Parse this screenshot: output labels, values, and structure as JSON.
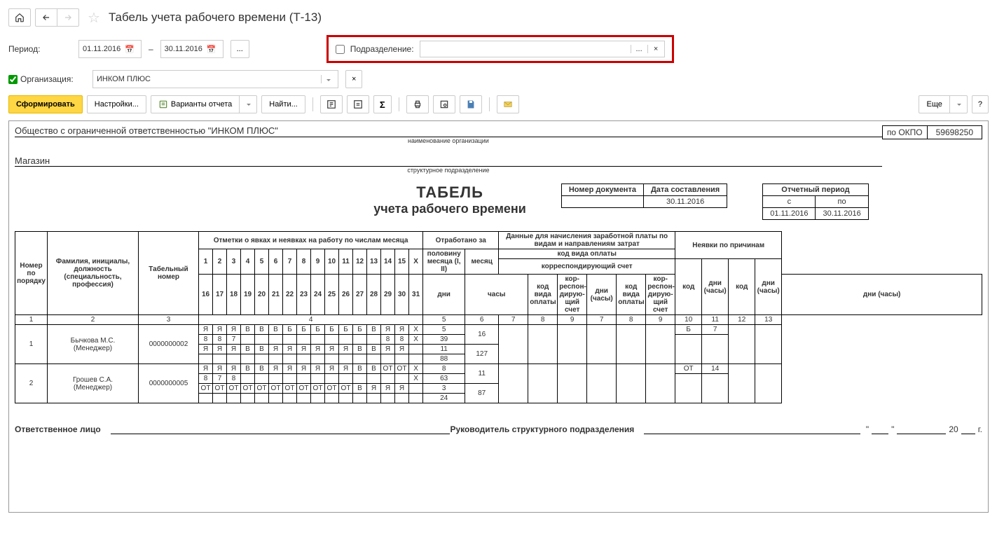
{
  "header": {
    "title": "Табель учета рабочего времени (Т-13)"
  },
  "filters": {
    "period_label": "Период:",
    "date_from": "01.11.2016",
    "date_dash": "–",
    "date_to": "30.11.2016",
    "dots": "...",
    "subdivision_label": "Подразделение:",
    "org_label": "Организация:",
    "org_value": "ИНКОМ ПЛЮС"
  },
  "toolbar": {
    "generate": "Сформировать",
    "settings": "Настройки...",
    "variants": "Варианты отчета",
    "find": "Найти...",
    "more": "Еще"
  },
  "report": {
    "org_name": "Общество с ограниченной ответственностью \"ИНКОМ ПЛЮС\"",
    "org_sub": "наименование организации",
    "okpo_label": "по ОКПО",
    "okpo_value": "59698250",
    "dept": "Магазин",
    "dept_sub": "структурное подразделение",
    "tabel1": "ТАБЕЛЬ",
    "tabel2": "учета  рабочего времени",
    "doc_number_label": "Номер документа",
    "doc_date_label": "Дата составления",
    "doc_date_value": "30.11.2016",
    "rep_period_label": "Отчетный период",
    "rep_from_label": "с",
    "rep_to_label": "по",
    "rep_from": "01.11.2016",
    "rep_to": "30.11.2016"
  },
  "columns": {
    "c1": "Номер по порядку",
    "c2": "Фамилия, инициалы, должность (специальность, профессия)",
    "c3": "Табельный номер",
    "c4": "Отметки о явках и неявках на работу по числам месяца",
    "c5": "Отработано за",
    "half": "половину месяца (I, II)",
    "month": "месяц",
    "days": "дни",
    "hours": "часы",
    "c6": "Данные для начисления заработной платы по видам и направлениям затрат",
    "pay_code": "код вида оплаты",
    "corr": "корреспондирующий счет",
    "kod": "код вида оплаты",
    "corr2": "кор-респон-дирую-щий счет",
    "dni": "дни (часы)",
    "c7": "Неявки по причинам",
    "abs_code": "код",
    "abs_days": "дни (часы)"
  },
  "day_row1": [
    "1",
    "2",
    "3",
    "4",
    "5",
    "6",
    "7",
    "8",
    "9",
    "10",
    "11",
    "12",
    "13",
    "14",
    "15",
    "X"
  ],
  "day_row2": [
    "16",
    "17",
    "18",
    "19",
    "20",
    "21",
    "22",
    "23",
    "24",
    "25",
    "26",
    "27",
    "28",
    "29",
    "30",
    "31"
  ],
  "colnums": {
    "a": "1",
    "b": "2",
    "c": "3",
    "d": "4",
    "e": "5",
    "f": "6",
    "g": "7",
    "h": "8",
    "i": "9",
    "j": "7",
    "k": "8",
    "l": "9",
    "m": "10",
    "n": "11",
    "o": "12",
    "p": "13"
  },
  "rows": [
    {
      "num": "1",
      "name": "Бычкова М.С.",
      "role": "(Менеджер)",
      "tab": "0000000002",
      "l1": [
        "Я",
        "Я",
        "Я",
        "В",
        "В",
        "В",
        "Б",
        "Б",
        "Б",
        "Б",
        "Б",
        "Б",
        "В",
        "Я",
        "Я",
        "X"
      ],
      "l2": [
        "8",
        "8",
        "7",
        "",
        "",
        "",
        "",
        "",
        "",
        "",
        "",
        "",
        "",
        "8",
        "8",
        "X"
      ],
      "l3": [
        "Я",
        "Я",
        "Я",
        "В",
        "В",
        "Я",
        "Я",
        "Я",
        "Я",
        "Я",
        "Я",
        "В",
        "В",
        "Я",
        "Я",
        ""
      ],
      "l4": [
        "",
        "",
        "",
        "",
        "",
        "",
        "",
        "",
        "",
        "",
        "",
        "",
        "",
        "",
        "",
        ""
      ],
      "half1": "5",
      "half1h": "39",
      "half2": "11",
      "half2h": "88",
      "mdays": "16",
      "mhours": "127",
      "abs_code": "Б",
      "abs_days": "7"
    },
    {
      "num": "2",
      "name": "Грошев  С.А.",
      "role": "(Менеджер)",
      "tab": "0000000005",
      "l1": [
        "Я",
        "Я",
        "Я",
        "В",
        "В",
        "Я",
        "Я",
        "Я",
        "Я",
        "Я",
        "Я",
        "В",
        "В",
        "ОТ",
        "ОТ",
        "X"
      ],
      "l2": [
        "8",
        "7",
        "8",
        "",
        "",
        "",
        "",
        "",
        "",
        "",
        "",
        "",
        "",
        "",
        "",
        "X"
      ],
      "l3": [
        "ОТ",
        "ОТ",
        "ОТ",
        "ОТ",
        "ОТ",
        "ОТ",
        "ОТ",
        "ОТ",
        "ОТ",
        "ОТ",
        "ОТ",
        "В",
        "Я",
        "Я",
        "Я",
        ""
      ],
      "l4": [
        "",
        "",
        "",
        "",
        "",
        "",
        "",
        "",
        "",
        "",
        "",
        "",
        "",
        "",
        "",
        ""
      ],
      "half1": "8",
      "half1h": "63",
      "half2": "3",
      "half2h": "24",
      "mdays": "11",
      "mhours": "87",
      "abs_code": "ОТ",
      "abs_days": "14"
    }
  ],
  "footer": {
    "resp": "Ответственное лицо",
    "head": "Руководитель структурного подразделения",
    "quote1": "\"",
    "quote2": "\"",
    "year_prefix": "20",
    "year_suffix": "г."
  }
}
